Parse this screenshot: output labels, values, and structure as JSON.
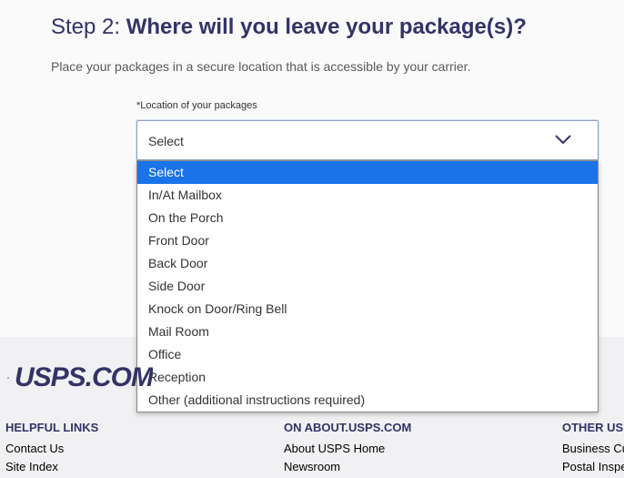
{
  "step": {
    "prefix": "Step 2:",
    "question": "Where will you leave your package(s)?",
    "subtitle": "Place your packages in a secure location that is accessible by your carrier."
  },
  "location_field": {
    "label": "*Location of your packages",
    "selected_value": "Select",
    "options": [
      "Select",
      "In/At Mailbox",
      "On the Porch",
      "Front Door",
      "Back Door",
      "Side Door",
      "Knock on Door/Ring Bell",
      "Mail Room",
      "Office",
      "Reception",
      "Other (additional instructions required)"
    ]
  },
  "footer": {
    "logo_text": "USPS.COM",
    "columns": [
      {
        "heading": "HELPFUL LINKS",
        "links": [
          "Contact Us",
          "Site Index"
        ]
      },
      {
        "heading": "ON ABOUT.USPS.COM",
        "links": [
          "About USPS Home",
          "Newsroom"
        ]
      },
      {
        "heading": "OTHER USPS SITES",
        "links": [
          "Business Customer Gateway",
          "Postal Inspectors"
        ]
      }
    ]
  },
  "colors": {
    "brand_navy": "#333366",
    "option_highlight": "#1a73e8"
  },
  "icons": {
    "select_chevron": "chevron-down-icon",
    "logo_mark": "usps-eagle-icon"
  }
}
